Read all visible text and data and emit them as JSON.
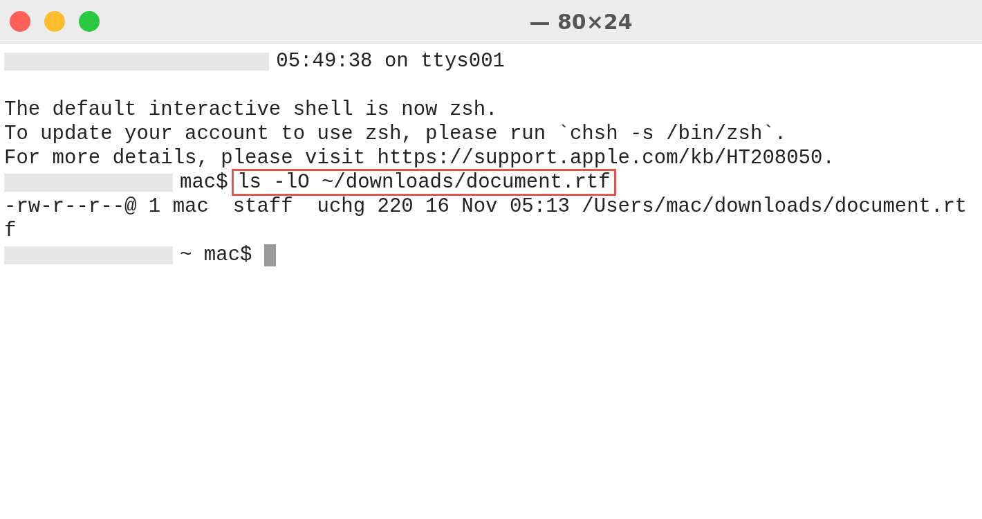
{
  "window": {
    "title": "— 80×24"
  },
  "lines": [
    {
      "kind": "text",
      "redacted": true,
      "text": "05:49:38 on ttys001"
    },
    {
      "kind": "blank"
    },
    {
      "kind": "text",
      "text": "The default interactive shell is now zsh."
    },
    {
      "kind": "text",
      "text": "To update your account to use zsh, please run `chsh -s /bin/zsh`."
    },
    {
      "kind": "text",
      "text": "For more details, please visit https://support.apple.com/kb/HT208050."
    },
    {
      "kind": "prompt",
      "redacted": true,
      "prompt": "mac$",
      "command": "ls -lO ~/downloads/document.rtf",
      "highlighted": true
    },
    {
      "kind": "text",
      "text": "-rw-r--r--@ 1 mac  staff  uchg 220 16 Nov 05:13 /Users/mac/downloads/document.rt"
    },
    {
      "kind": "text",
      "text": "f"
    },
    {
      "kind": "prompt",
      "redacted": true,
      "prompt": "~ mac$",
      "cursor": true
    }
  ]
}
